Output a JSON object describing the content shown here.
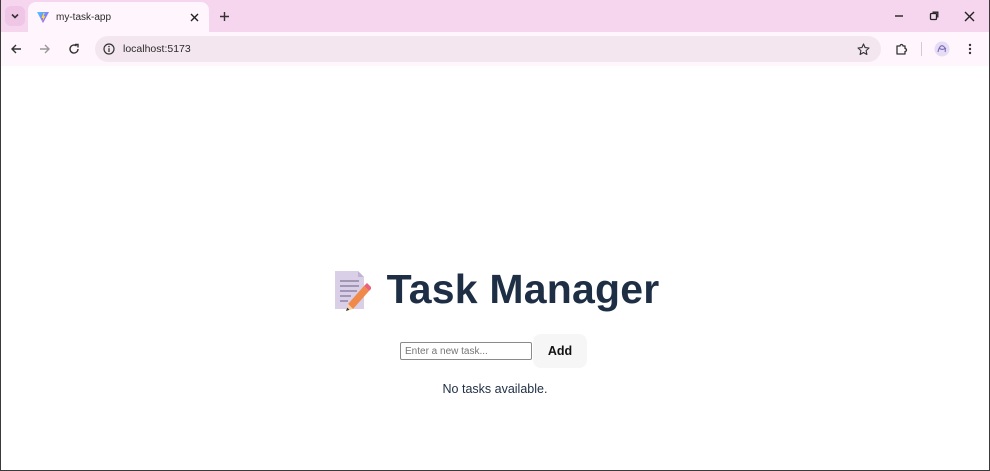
{
  "browser": {
    "tab": {
      "title": "my-task-app"
    },
    "url": "localhost:5173"
  },
  "app": {
    "title": "Task Manager",
    "input_placeholder": "Enter a new task...",
    "add_label": "Add",
    "empty_message": "No tasks available."
  },
  "icons": {
    "tab_search": "chevron-down-icon",
    "favicon": "vite-icon",
    "tab_close": "close-icon",
    "new_tab": "plus-icon",
    "minimize": "minimize-icon",
    "restore": "restore-icon",
    "close_window": "close-icon",
    "back": "arrow-left-icon",
    "forward": "arrow-right-icon",
    "reload": "reload-icon",
    "site_info": "info-icon",
    "bookmark": "star-icon",
    "extensions": "puzzle-icon",
    "profile": "profile-icon",
    "menu": "kebab-menu-icon",
    "heading": "memo-icon"
  },
  "colors": {
    "tabstrip": "#f6d5ef",
    "toolbar": "#fff5fc",
    "omnibox": "#f3e6ef",
    "heading_text": "#1e2e44",
    "button_bg": "#f6f6f6"
  }
}
